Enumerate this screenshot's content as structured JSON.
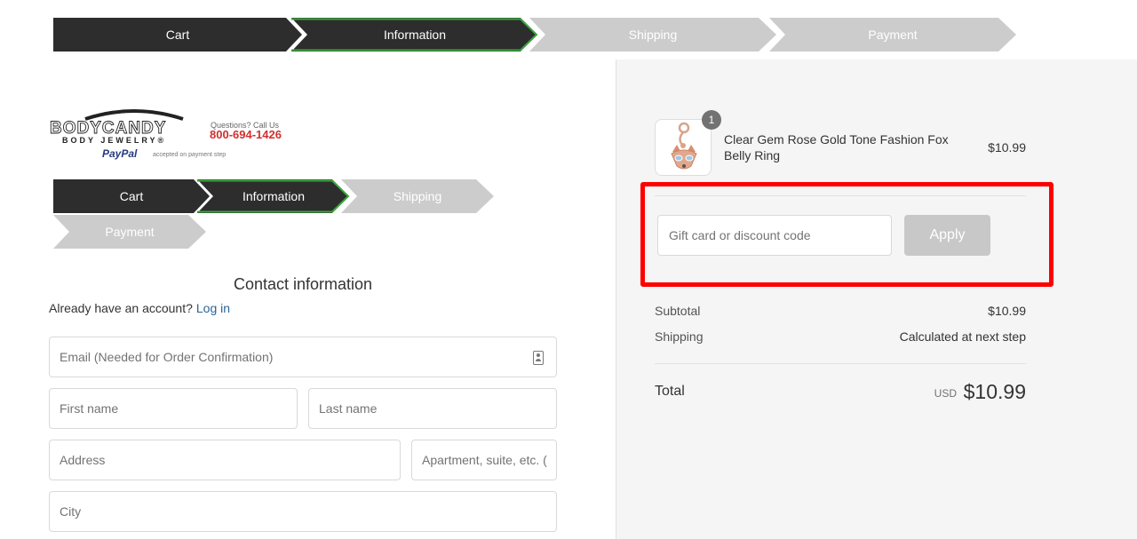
{
  "breadcrumb": {
    "steps": [
      {
        "label": "Cart",
        "state": "complete"
      },
      {
        "label": "Information",
        "state": "current"
      },
      {
        "label": "Shipping",
        "state": "upcoming"
      },
      {
        "label": "Payment",
        "state": "upcoming"
      }
    ]
  },
  "logo": {
    "brand_top": "BODYCANDY",
    "brand_bottom": "BODY JEWELRY®",
    "questions": "Questions? Call Us",
    "phone": "800-694-1426",
    "paypal": "PayPal",
    "paypal_note": "accepted on payment step"
  },
  "contact": {
    "title": "Contact information",
    "account_prompt": "Already have an account?",
    "login_link": "Log in",
    "fields": {
      "email": "Email (Needed for Order Confirmation)",
      "first_name": "First name",
      "last_name": "Last name",
      "address": "Address",
      "apartment": "Apartment, suite, etc. (",
      "city": "City"
    }
  },
  "summary": {
    "product": {
      "name": "Clear Gem Rose Gold Tone Fashion Fox Belly Ring",
      "price": "$10.99",
      "quantity": "1"
    },
    "discount": {
      "placeholder": "Gift card or discount code",
      "apply_label": "Apply"
    },
    "subtotal_label": "Subtotal",
    "subtotal_value": "$10.99",
    "shipping_label": "Shipping",
    "shipping_value": "Calculated at next step",
    "total_label": "Total",
    "total_currency": "USD",
    "total_value": "$10.99"
  },
  "colors": {
    "step_active": "#2d2d2d",
    "step_inactive": "#cccccc",
    "step_accent": "#3aa63a",
    "link": "#2a6496",
    "highlight": "#ff0000",
    "phone": "#d22e2e"
  }
}
